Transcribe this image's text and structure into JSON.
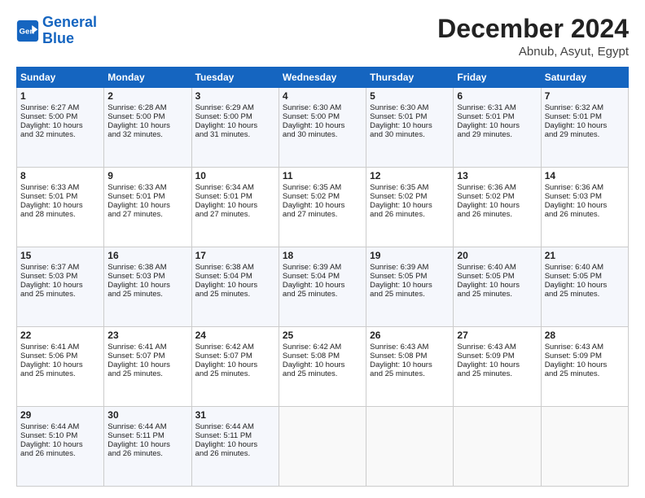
{
  "logo": {
    "line1": "General",
    "line2": "Blue"
  },
  "title": "December 2024",
  "subtitle": "Abnub, Asyut, Egypt",
  "days_of_week": [
    "Sunday",
    "Monday",
    "Tuesday",
    "Wednesday",
    "Thursday",
    "Friday",
    "Saturday"
  ],
  "weeks": [
    [
      {
        "day": "1",
        "lines": [
          "Sunrise: 6:27 AM",
          "Sunset: 5:00 PM",
          "Daylight: 10 hours",
          "and 32 minutes."
        ]
      },
      {
        "day": "2",
        "lines": [
          "Sunrise: 6:28 AM",
          "Sunset: 5:00 PM",
          "Daylight: 10 hours",
          "and 32 minutes."
        ]
      },
      {
        "day": "3",
        "lines": [
          "Sunrise: 6:29 AM",
          "Sunset: 5:00 PM",
          "Daylight: 10 hours",
          "and 31 minutes."
        ]
      },
      {
        "day": "4",
        "lines": [
          "Sunrise: 6:30 AM",
          "Sunset: 5:00 PM",
          "Daylight: 10 hours",
          "and 30 minutes."
        ]
      },
      {
        "day": "5",
        "lines": [
          "Sunrise: 6:30 AM",
          "Sunset: 5:01 PM",
          "Daylight: 10 hours",
          "and 30 minutes."
        ]
      },
      {
        "day": "6",
        "lines": [
          "Sunrise: 6:31 AM",
          "Sunset: 5:01 PM",
          "Daylight: 10 hours",
          "and 29 minutes."
        ]
      },
      {
        "day": "7",
        "lines": [
          "Sunrise: 6:32 AM",
          "Sunset: 5:01 PM",
          "Daylight: 10 hours",
          "and 29 minutes."
        ]
      }
    ],
    [
      {
        "day": "8",
        "lines": [
          "Sunrise: 6:33 AM",
          "Sunset: 5:01 PM",
          "Daylight: 10 hours",
          "and 28 minutes."
        ]
      },
      {
        "day": "9",
        "lines": [
          "Sunrise: 6:33 AM",
          "Sunset: 5:01 PM",
          "Daylight: 10 hours",
          "and 27 minutes."
        ]
      },
      {
        "day": "10",
        "lines": [
          "Sunrise: 6:34 AM",
          "Sunset: 5:01 PM",
          "Daylight: 10 hours",
          "and 27 minutes."
        ]
      },
      {
        "day": "11",
        "lines": [
          "Sunrise: 6:35 AM",
          "Sunset: 5:02 PM",
          "Daylight: 10 hours",
          "and 27 minutes."
        ]
      },
      {
        "day": "12",
        "lines": [
          "Sunrise: 6:35 AM",
          "Sunset: 5:02 PM",
          "Daylight: 10 hours",
          "and 26 minutes."
        ]
      },
      {
        "day": "13",
        "lines": [
          "Sunrise: 6:36 AM",
          "Sunset: 5:02 PM",
          "Daylight: 10 hours",
          "and 26 minutes."
        ]
      },
      {
        "day": "14",
        "lines": [
          "Sunrise: 6:36 AM",
          "Sunset: 5:03 PM",
          "Daylight: 10 hours",
          "and 26 minutes."
        ]
      }
    ],
    [
      {
        "day": "15",
        "lines": [
          "Sunrise: 6:37 AM",
          "Sunset: 5:03 PM",
          "Daylight: 10 hours",
          "and 25 minutes."
        ]
      },
      {
        "day": "16",
        "lines": [
          "Sunrise: 6:38 AM",
          "Sunset: 5:03 PM",
          "Daylight: 10 hours",
          "and 25 minutes."
        ]
      },
      {
        "day": "17",
        "lines": [
          "Sunrise: 6:38 AM",
          "Sunset: 5:04 PM",
          "Daylight: 10 hours",
          "and 25 minutes."
        ]
      },
      {
        "day": "18",
        "lines": [
          "Sunrise: 6:39 AM",
          "Sunset: 5:04 PM",
          "Daylight: 10 hours",
          "and 25 minutes."
        ]
      },
      {
        "day": "19",
        "lines": [
          "Sunrise: 6:39 AM",
          "Sunset: 5:05 PM",
          "Daylight: 10 hours",
          "and 25 minutes."
        ]
      },
      {
        "day": "20",
        "lines": [
          "Sunrise: 6:40 AM",
          "Sunset: 5:05 PM",
          "Daylight: 10 hours",
          "and 25 minutes."
        ]
      },
      {
        "day": "21",
        "lines": [
          "Sunrise: 6:40 AM",
          "Sunset: 5:05 PM",
          "Daylight: 10 hours",
          "and 25 minutes."
        ]
      }
    ],
    [
      {
        "day": "22",
        "lines": [
          "Sunrise: 6:41 AM",
          "Sunset: 5:06 PM",
          "Daylight: 10 hours",
          "and 25 minutes."
        ]
      },
      {
        "day": "23",
        "lines": [
          "Sunrise: 6:41 AM",
          "Sunset: 5:07 PM",
          "Daylight: 10 hours",
          "and 25 minutes."
        ]
      },
      {
        "day": "24",
        "lines": [
          "Sunrise: 6:42 AM",
          "Sunset: 5:07 PM",
          "Daylight: 10 hours",
          "and 25 minutes."
        ]
      },
      {
        "day": "25",
        "lines": [
          "Sunrise: 6:42 AM",
          "Sunset: 5:08 PM",
          "Daylight: 10 hours",
          "and 25 minutes."
        ]
      },
      {
        "day": "26",
        "lines": [
          "Sunrise: 6:43 AM",
          "Sunset: 5:08 PM",
          "Daylight: 10 hours",
          "and 25 minutes."
        ]
      },
      {
        "day": "27",
        "lines": [
          "Sunrise: 6:43 AM",
          "Sunset: 5:09 PM",
          "Daylight: 10 hours",
          "and 25 minutes."
        ]
      },
      {
        "day": "28",
        "lines": [
          "Sunrise: 6:43 AM",
          "Sunset: 5:09 PM",
          "Daylight: 10 hours",
          "and 25 minutes."
        ]
      }
    ],
    [
      {
        "day": "29",
        "lines": [
          "Sunrise: 6:44 AM",
          "Sunset: 5:10 PM",
          "Daylight: 10 hours",
          "and 26 minutes."
        ]
      },
      {
        "day": "30",
        "lines": [
          "Sunrise: 6:44 AM",
          "Sunset: 5:11 PM",
          "Daylight: 10 hours",
          "and 26 minutes."
        ]
      },
      {
        "day": "31",
        "lines": [
          "Sunrise: 6:44 AM",
          "Sunset: 5:11 PM",
          "Daylight: 10 hours",
          "and 26 minutes."
        ]
      },
      {
        "day": "",
        "lines": []
      },
      {
        "day": "",
        "lines": []
      },
      {
        "day": "",
        "lines": []
      },
      {
        "day": "",
        "lines": []
      }
    ]
  ]
}
